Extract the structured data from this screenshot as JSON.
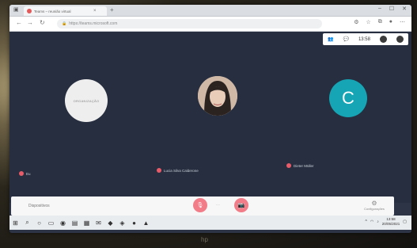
{
  "browser": {
    "tab_title": "Teams – reunião virtual",
    "new_tab": "+",
    "url": "https://teams.microsoft.com",
    "window_controls": [
      "–",
      "☐",
      "✕"
    ]
  },
  "meeting": {
    "clock": "13:58",
    "participants": [
      {
        "name": "Eu",
        "avatar": "logo",
        "muted": true
      },
      {
        "name": "Lucia Silva Calderone",
        "avatar": "photo",
        "muted": true
      },
      {
        "name": "Dieter Müller",
        "avatar": "letter",
        "initial": "C",
        "muted": true
      }
    ],
    "devices_label": "Dispositivos",
    "settings_label": "Configurações"
  },
  "taskbar": {
    "time": "13:58",
    "date": "20/05/2021"
  },
  "device_brand": "hp",
  "colors": {
    "accent_teal": "#16a5b5",
    "mute_red": "#f27c88"
  }
}
